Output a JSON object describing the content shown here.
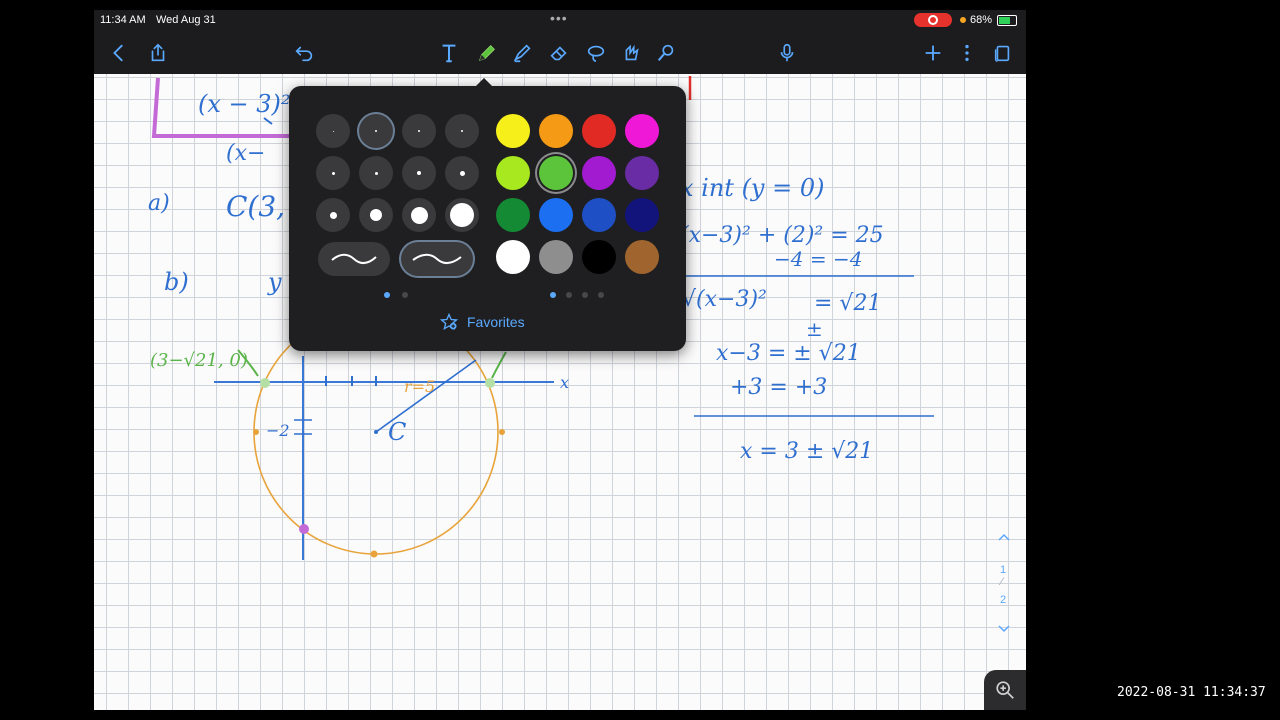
{
  "status_bar": {
    "time": "11:34 AM",
    "date": "Wed Aug 31",
    "battery": "68%"
  },
  "toolbar": {
    "left": [
      "back-icon",
      "share-icon",
      "undo-icon"
    ],
    "tools": [
      "text-tool-icon",
      "pen-tool-icon",
      "highlighter-tool-icon",
      "eraser-tool-icon",
      "lasso-tool-icon",
      "shapes-tool-icon",
      "laser-pointer-icon"
    ],
    "right": [
      "microphone-icon",
      "add-page-icon",
      "more-icon",
      "pages-icon"
    ],
    "active_tool": "pen",
    "accent": "#5aa9ff"
  },
  "notes": {
    "eq_boxed": "(x − 3)²",
    "eq_partial": "(x−",
    "part_a": "a)",
    "center_partial": "C(3,",
    "part_b": "b)",
    "b_partial": "y",
    "x_int_heading": "x int (y = 0)",
    "step1": "(x−3)² + (2)² = 25",
    "step2": "−4     = −4",
    "step3": "√(x−3)²",
    "step3b": "= √21",
    "step3c": "±",
    "step4": "x−3 = ± √21",
    "step5": "+3 = +3",
    "result": "x = 3 ± √21",
    "point_label": "(3−√21, 0)",
    "radius_label": "r=5",
    "tick_label": "−2",
    "center_label": "C",
    "axis_x": "x",
    "colors": {
      "ink_blue": "#2f6fd0",
      "green": "#5ab44a",
      "orange": "#e8a33a",
      "purple": "#c46ad6",
      "red": "#e0302c"
    }
  },
  "pen_popover": {
    "sizes": 12,
    "selected_size": 2,
    "strokes": [
      "smooth",
      "smoothed-selected"
    ],
    "colors": [
      "#f7ef1a",
      "#f59a14",
      "#e22a24",
      "#ee18d6",
      "#a8e81e",
      "#5cc43b",
      "#a21bd0",
      "#6a2ca4",
      "#148a35",
      "#1b6ff0",
      "#1f4fc4",
      "#13137c",
      "#ffffff",
      "#8e8e8e",
      "#000000",
      "#a0652e"
    ],
    "selected_color": "#5cc43b",
    "favorites_label": "Favorites"
  },
  "pager": {
    "page_current": "1",
    "page_total": "2"
  },
  "timestamp": "2022-08-31 11:34:37"
}
